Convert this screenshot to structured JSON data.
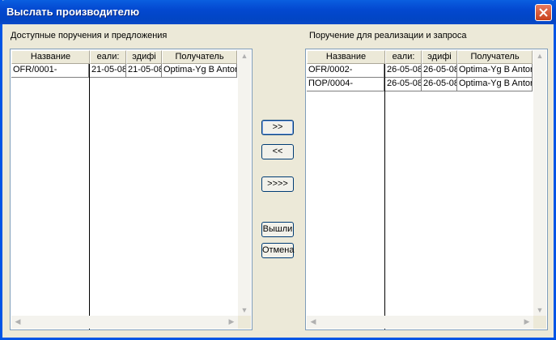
{
  "window": {
    "title": "Выслать производителю"
  },
  "left": {
    "label": "Доступные поручения и предложения",
    "columns": [
      "Название",
      "еали:",
      "эдифі",
      "Получатель"
    ],
    "rows": [
      {
        "name": "OFR/0001-",
        "c1": "21-05-08",
        "c2": "21-05-08",
        "recipient": "Optima-Yg B Antor"
      }
    ]
  },
  "right": {
    "label": "Поручение для реализации и запроса",
    "columns": [
      "Название",
      "еали:",
      "эдифі",
      "Получатель"
    ],
    "rows": [
      {
        "name": "OFR/0002-",
        "c1": "26-05-08",
        "c2": "26-05-08",
        "recipient": "Optima-Yg B Antor"
      },
      {
        "name": "ПОР/0004-",
        "c1": "26-05-08",
        "c2": "26-05-08",
        "recipient": "Optima-Yg B Antor"
      }
    ]
  },
  "buttons": {
    "move_right": ">>",
    "move_left": "<<",
    "move_all": ">>>>",
    "send": "Вышли",
    "cancel": "Отмена"
  },
  "icons": {
    "close": "close-icon",
    "scroll_up": "arrow-up-icon",
    "scroll_down": "arrow-down-icon",
    "scroll_left": "arrow-left-icon",
    "scroll_right": "arrow-right-icon"
  }
}
